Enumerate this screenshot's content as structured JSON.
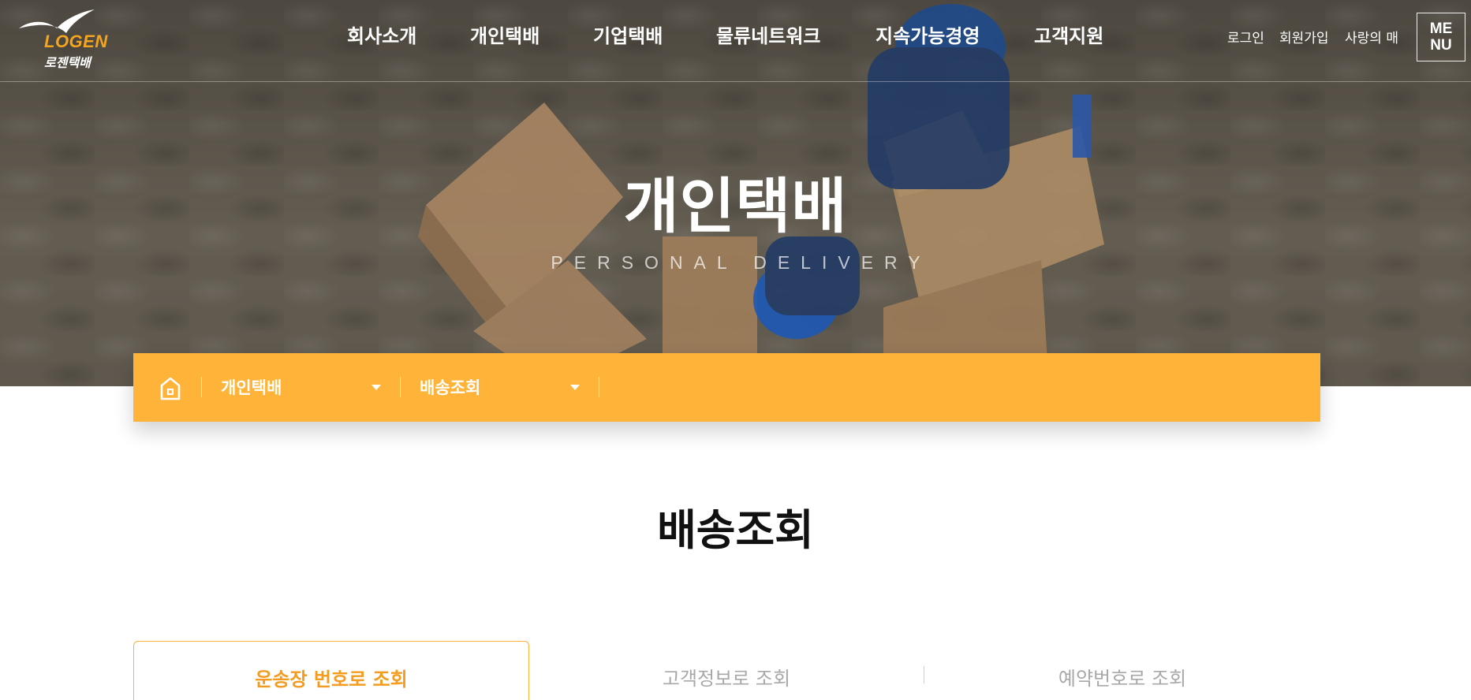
{
  "logo": {
    "en": "LOGEN",
    "ko": "로젠택배"
  },
  "nav": {
    "items": [
      {
        "label": "회사소개"
      },
      {
        "label": "개인택배"
      },
      {
        "label": "기업택배"
      },
      {
        "label": "물류네트워크"
      },
      {
        "label": "지속가능경영"
      },
      {
        "label": "고객지원"
      }
    ]
  },
  "util": {
    "login": "로그인",
    "signup": "회원가입",
    "charity": "사랑의 매"
  },
  "menu_button": {
    "line1": "ME",
    "line2": "NU"
  },
  "hero": {
    "title": "개인택배",
    "subtitle": "PERSONAL DELIVERY"
  },
  "breadcrumb": {
    "home_icon": "home-icon",
    "level1": "개인택배",
    "level2": "배송조회"
  },
  "page": {
    "title": "배송조회"
  },
  "tabs": [
    {
      "label": "운송장 번호로 조회",
      "active": true
    },
    {
      "label": "고객정보로 조회",
      "active": false
    },
    {
      "label": "예약번호로 조회",
      "active": false
    }
  ],
  "colors": {
    "accent": "#ffb339",
    "accent_text": "#f39c1f",
    "brand_logo": "#f3a51f"
  }
}
